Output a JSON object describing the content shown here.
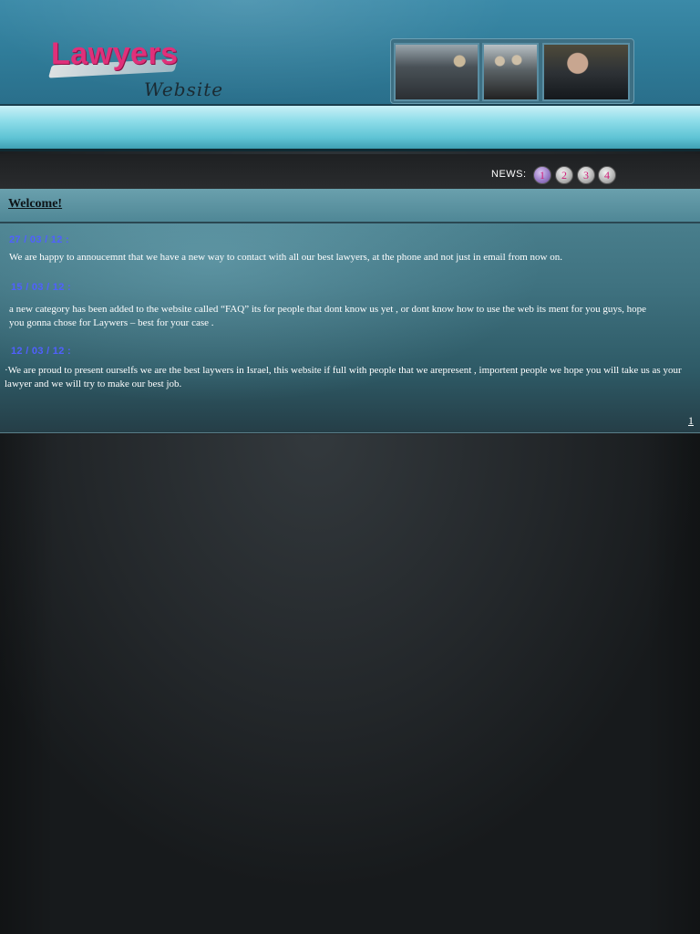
{
  "header": {
    "logo_title": "Lawyers",
    "logo_subtitle": "Website"
  },
  "news_nav": {
    "label": "NEWS:",
    "pages": [
      "1",
      "2",
      "3",
      "4"
    ],
    "active_page": "1"
  },
  "welcome": {
    "title": "Welcome!"
  },
  "news": [
    {
      "date": "27 / 03 / 12 :",
      "text": "We are happy to annoucemnt that we have a new way to contact with all our best lawyers, at the phone and not just in email from now on."
    },
    {
      "date": "15 / 03 / 12 :",
      "text": "a new  category has been added to the website called “FAQ” its for people that dont know us yet , or dont know how to use the web its ment for you guys, hope you gonna chose for Laywers – best for your case ."
    },
    {
      "date": "12 / 03 / 12 :",
      "text": "·We are proud to present ourselfs we are the best laywers in Israel, this website if full with people that we arepresent , importent people we hope you will take us as your lawyer and we will try to make our best job."
    }
  ],
  "pager": {
    "current": "1"
  },
  "colors": {
    "header_bg": "#2f7b98",
    "logo_pink": "#e0307a",
    "date_blue": "#5060ff",
    "nav_cyan": "#8edde9"
  }
}
